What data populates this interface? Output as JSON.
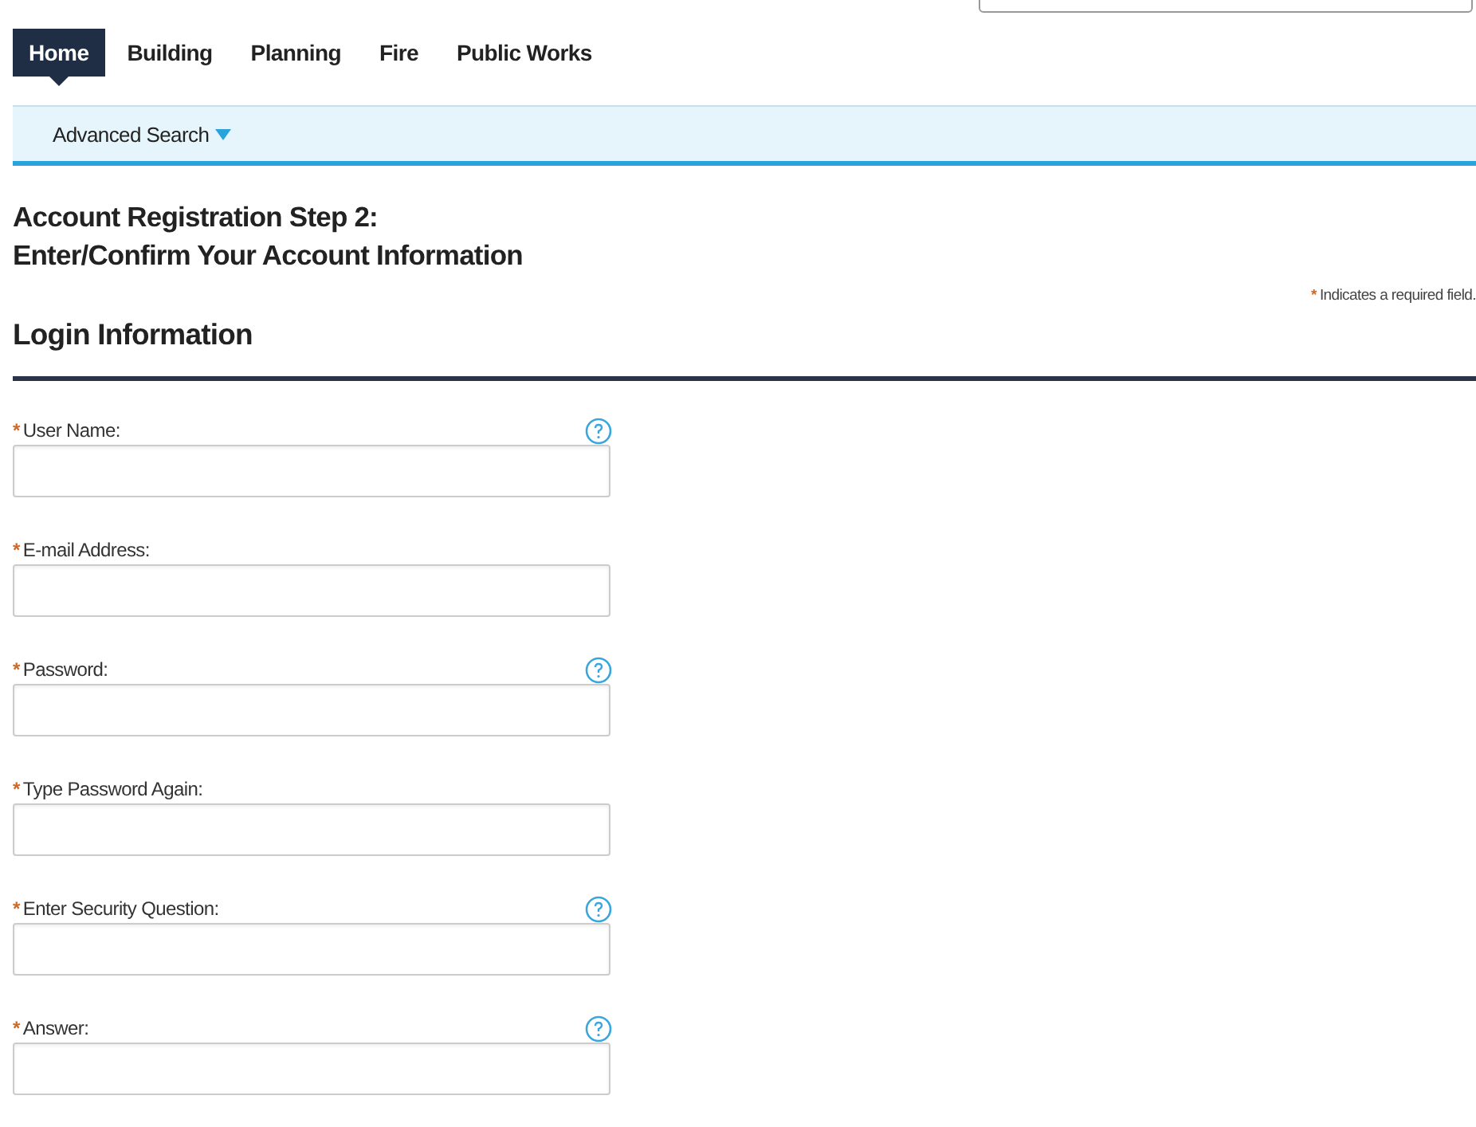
{
  "tabs": [
    {
      "label": "Home",
      "selected": true
    },
    {
      "label": "Building",
      "selected": false
    },
    {
      "label": "Planning",
      "selected": false
    },
    {
      "label": "Fire",
      "selected": false
    },
    {
      "label": "Public Works",
      "selected": false
    }
  ],
  "subnav": {
    "label": "Advanced Search"
  },
  "title_lines": [
    "Account Registration Step 2:",
    "Enter/Confirm Your Account Information"
  ],
  "required_note": {
    "marker": "*",
    "text": "Indicates a required field."
  },
  "section_title": "Login Information",
  "fields": [
    {
      "marker": "*",
      "label": "User Name:",
      "help": true
    },
    {
      "marker": "*",
      "label": "E-mail Address:",
      "help": false
    },
    {
      "marker": "*",
      "label": "Password:",
      "help": true
    },
    {
      "marker": "*",
      "label": "Type Password Again:",
      "help": false
    },
    {
      "marker": "*",
      "label": "Enter Security Question:",
      "help": true
    },
    {
      "marker": "*",
      "label": "Answer:",
      "help": true
    }
  ]
}
